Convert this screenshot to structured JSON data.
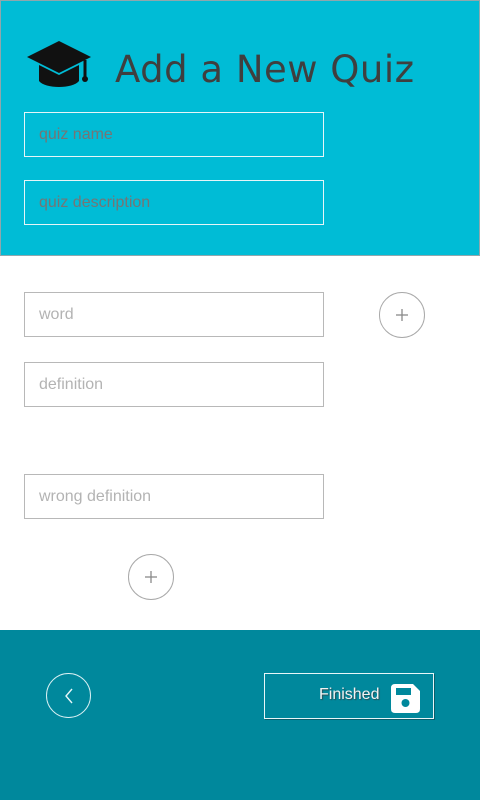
{
  "header": {
    "title": "Add a New Quiz",
    "icon": "graduation-cap-icon",
    "bg_color": "#00bcd6"
  },
  "quiz_fields": {
    "name_placeholder": "quiz name",
    "name_value": "",
    "description_placeholder": "quiz description",
    "description_value": ""
  },
  "word_entry": {
    "word_placeholder": "word",
    "word_value": "",
    "definition_placeholder": "definition",
    "definition_value": "",
    "wrong_definition_placeholder": "wrong definition",
    "wrong_definition_value": "",
    "add_word_icon": "plus-icon",
    "add_wrong_definition_icon": "plus-icon"
  },
  "footer": {
    "bg_color": "#00889c",
    "back_icon": "chevron-left-icon",
    "finished_label": "Finished",
    "finished_icon": "floppy-disk-icon"
  }
}
